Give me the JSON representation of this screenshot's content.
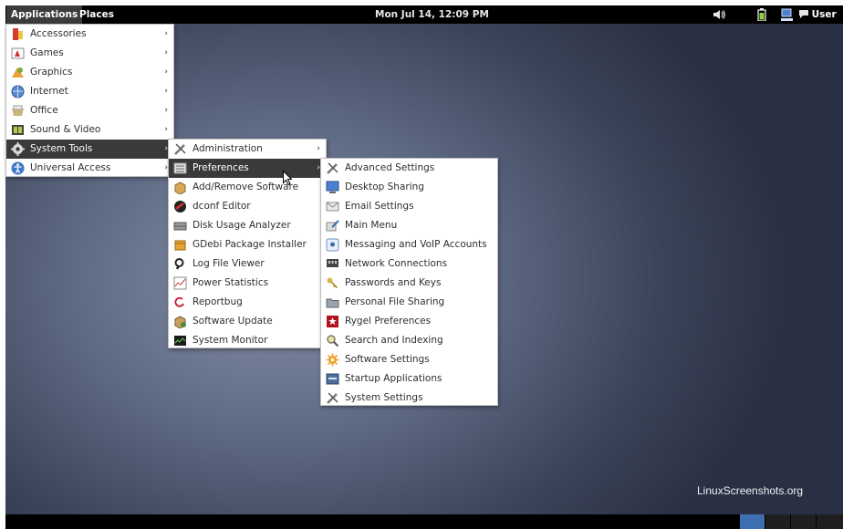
{
  "panel": {
    "applications_label": "Applications",
    "places_label": "Places",
    "clock": "Mon Jul 14, 12:09 PM",
    "user_label": "User"
  },
  "watermark": "LinuxScreenshots.org",
  "arrow": "›",
  "main_menu": [
    {
      "label": "Accessories",
      "icon": "accessories-icon"
    },
    {
      "label": "Games",
      "icon": "games-icon"
    },
    {
      "label": "Graphics",
      "icon": "graphics-icon"
    },
    {
      "label": "Internet",
      "icon": "internet-icon"
    },
    {
      "label": "Office",
      "icon": "office-icon"
    },
    {
      "label": "Sound & Video",
      "icon": "sound-video-icon"
    },
    {
      "label": "System Tools",
      "icon": "system-tools-icon",
      "highlighted": true
    },
    {
      "label": "Universal Access",
      "icon": "universal-access-icon"
    }
  ],
  "system_tools_menu": [
    {
      "label": "Administration",
      "icon": "administration-icon",
      "submenu": true
    },
    {
      "label": "Preferences",
      "icon": "preferences-icon",
      "submenu": true,
      "highlighted": true
    },
    {
      "label": "Add/Remove Software",
      "icon": "add-remove-software-icon"
    },
    {
      "label": "dconf Editor",
      "icon": "dconf-editor-icon"
    },
    {
      "label": "Disk Usage Analyzer",
      "icon": "disk-usage-icon"
    },
    {
      "label": "GDebi Package Installer",
      "icon": "gdebi-icon"
    },
    {
      "label": "Log File Viewer",
      "icon": "log-viewer-icon"
    },
    {
      "label": "Power Statistics",
      "icon": "power-statistics-icon"
    },
    {
      "label": "Reportbug",
      "icon": "reportbug-icon"
    },
    {
      "label": "Software Update",
      "icon": "software-update-icon"
    },
    {
      "label": "System Monitor",
      "icon": "system-monitor-icon"
    }
  ],
  "preferences_menu": [
    {
      "label": "Advanced Settings",
      "icon": "advanced-settings-icon"
    },
    {
      "label": "Desktop Sharing",
      "icon": "desktop-sharing-icon"
    },
    {
      "label": "Email Settings",
      "icon": "email-settings-icon"
    },
    {
      "label": "Main Menu",
      "icon": "main-menu-icon"
    },
    {
      "label": "Messaging and VoIP Accounts",
      "icon": "messaging-icon"
    },
    {
      "label": "Network Connections",
      "icon": "network-connections-icon"
    },
    {
      "label": "Passwords and Keys",
      "icon": "passwords-keys-icon"
    },
    {
      "label": "Personal File Sharing",
      "icon": "file-sharing-icon"
    },
    {
      "label": "Rygel Preferences",
      "icon": "rygel-icon"
    },
    {
      "label": "Search and Indexing",
      "icon": "search-indexing-icon"
    },
    {
      "label": "Software Settings",
      "icon": "software-settings-icon"
    },
    {
      "label": "Startup Applications",
      "icon": "startup-applications-icon"
    },
    {
      "label": "System Settings",
      "icon": "system-settings-icon"
    }
  ],
  "colors": {
    "panel_bg": "#000000",
    "highlight_bg": "#3a3a3a",
    "workspace_active": "#3e6fb1"
  }
}
